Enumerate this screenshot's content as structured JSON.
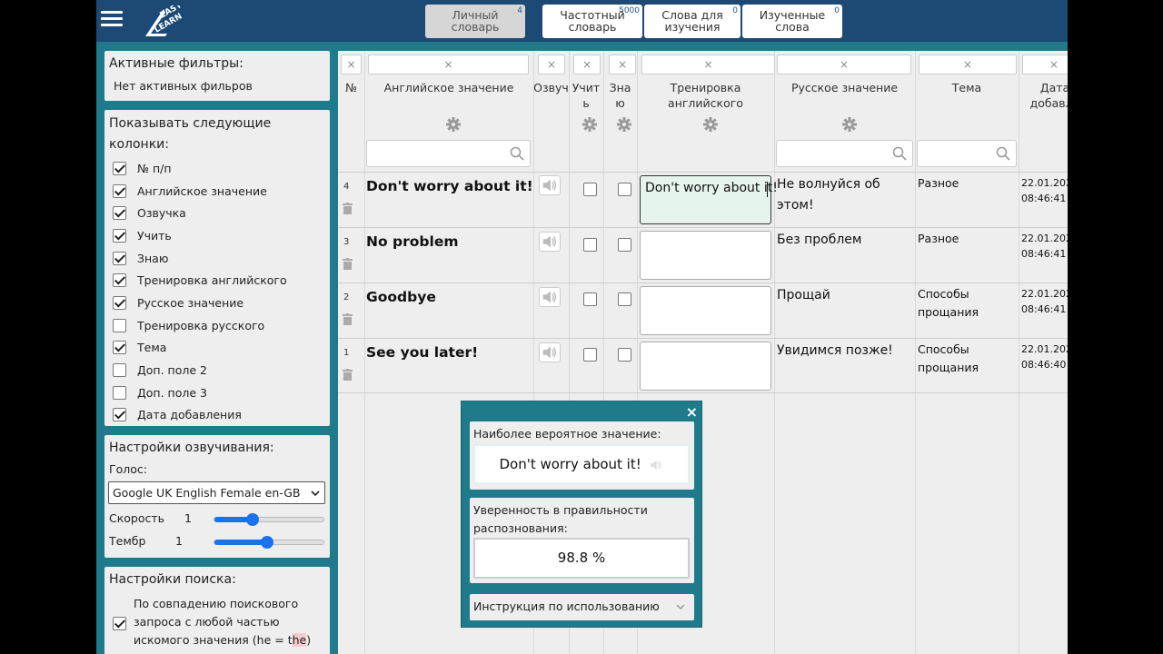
{
  "header": {
    "tabs": [
      {
        "line1": "Личный",
        "line2": "словарь",
        "badge": "4"
      },
      {
        "line1": "Частотный",
        "line2": "словарь",
        "badge": "5000"
      },
      {
        "line1": "Слова для",
        "line2": "изучения",
        "badge": "0"
      },
      {
        "line1": "Изученные",
        "line2": "слова",
        "badge": "0"
      }
    ],
    "logo": "EASY-LEARN"
  },
  "sidebar": {
    "filters": {
      "title": "Активные фильтры:",
      "text": "Нет активных фильров"
    },
    "columns": {
      "title_line1": "Показывать следующие",
      "title_line2": "колонки:",
      "items": [
        {
          "label": "№ п/п",
          "checked": true
        },
        {
          "label": "Английское значение",
          "checked": true
        },
        {
          "label": "Озвучка",
          "checked": true
        },
        {
          "label": "Учить",
          "checked": true
        },
        {
          "label": "Знаю",
          "checked": true
        },
        {
          "label": "Тренировка английского",
          "checked": true
        },
        {
          "label": "Русское значение",
          "checked": true
        },
        {
          "label": "Тренировка русского",
          "checked": false
        },
        {
          "label": "Тема",
          "checked": true
        },
        {
          "label": "Доп. поле 2",
          "checked": false
        },
        {
          "label": "Доп. поле 3",
          "checked": false
        },
        {
          "label": "Дата добавления",
          "checked": true
        }
      ]
    },
    "voice": {
      "title": "Настройки озвучивания:",
      "voice_label": "Голос:",
      "voice_value": "Google UK English Female en-GB",
      "speed_label": "Скорость",
      "speed_value": "1",
      "speed_level": 0.35,
      "pitch_label": "Тембр",
      "pitch_value": "1",
      "pitch_level": 0.48
    },
    "search": {
      "title": "Настройки поиска:",
      "option_line1": "По совпадению поискового",
      "option_line2": "запроса с любой частью",
      "option_line3_pre": "искомого значения (he = t",
      "option_line3_hl": "he",
      "option_line3_post": ")",
      "checked": true
    }
  },
  "table": {
    "filter_clear": "×",
    "headers": {
      "num": "№",
      "english": "Английское значение",
      "voice": "Озвуч",
      "learn_1": "Учит",
      "learn_2": "ь",
      "know_1": "Зна",
      "know_2": "ю",
      "train_en_1": "Тренировка",
      "train_en_2": "английского",
      "russian": "Русское значение",
      "theme": "Тема",
      "date_1": "Дата",
      "date_2": "добавле"
    },
    "rows": [
      {
        "num": "4",
        "english": "Don't worry about it!",
        "training": "Don't worry about it!",
        "russian_1": "Не волнуйся об",
        "russian_2": "этом!",
        "theme_1": "Разное",
        "theme_2": "",
        "date_1": "22.01.202",
        "date_2": "08:46:41"
      },
      {
        "num": "3",
        "english": "No problem",
        "training": "",
        "russian_1": "Без проблем",
        "russian_2": "",
        "theme_1": "Разное",
        "theme_2": "",
        "date_1": "22.01.202",
        "date_2": "08:46:41"
      },
      {
        "num": "2",
        "english": "Goodbye",
        "training": "",
        "russian_1": "Прощай",
        "russian_2": "",
        "theme_1": "Способы",
        "theme_2": "прощания",
        "date_1": "22.01.202",
        "date_2": "08:46:41"
      },
      {
        "num": "1",
        "english": "See you later!",
        "training": "",
        "russian_1": "Увидимся позже!",
        "russian_2": "",
        "theme_1": "Способы",
        "theme_2": "прощания",
        "date_1": "22.01.202",
        "date_2": "08:46:40"
      }
    ]
  },
  "popup": {
    "close": "×",
    "likely_label": "Наиболее вероятное значение:",
    "likely_value": "Don't worry about it!",
    "confidence_label_1": "Уверенность в правильности",
    "confidence_label_2": "распознования:",
    "confidence_value": "98.8 %",
    "instructions": "Инструкция по использованию"
  },
  "colors": {
    "header": "#1c4a75",
    "frame": "#1f7a8c",
    "panel": "#eeeeee",
    "accent": "#1a73e8"
  }
}
